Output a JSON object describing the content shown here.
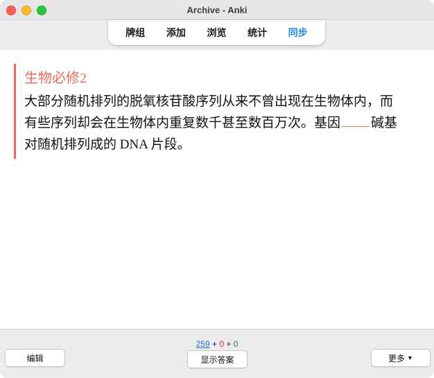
{
  "window": {
    "title": "Archive - Anki"
  },
  "toolbar": {
    "items": [
      {
        "label": "牌组",
        "active": false
      },
      {
        "label": "添加",
        "active": false
      },
      {
        "label": "浏览",
        "active": false
      },
      {
        "label": "统计",
        "active": false
      },
      {
        "label": "同步",
        "active": true
      }
    ]
  },
  "card": {
    "deck_title": "生物必修2",
    "text_line1": "大部分随机排列的脱氧核苷酸序列从来不曾出现在生物体内，而",
    "text_line2_pre": "有些序列却会在生物体内重复数千甚至数百万次。基因",
    "text_line2_post": "碱基",
    "text_line3": "对随机排列成的 DNA 片段。"
  },
  "bottom": {
    "edit_label": "编辑",
    "show_answer_label": "显示答案",
    "more_label": "更多",
    "counts": {
      "new": "259",
      "plus1": " + ",
      "learn": "0",
      "plus2": " + ",
      "review": "0"
    }
  },
  "colors": {
    "accent": "#ef6b57",
    "active_tab": "#1e88e5",
    "new": "#1e6fd9",
    "learn": "#d32f2f",
    "review": "#2e7d32"
  }
}
